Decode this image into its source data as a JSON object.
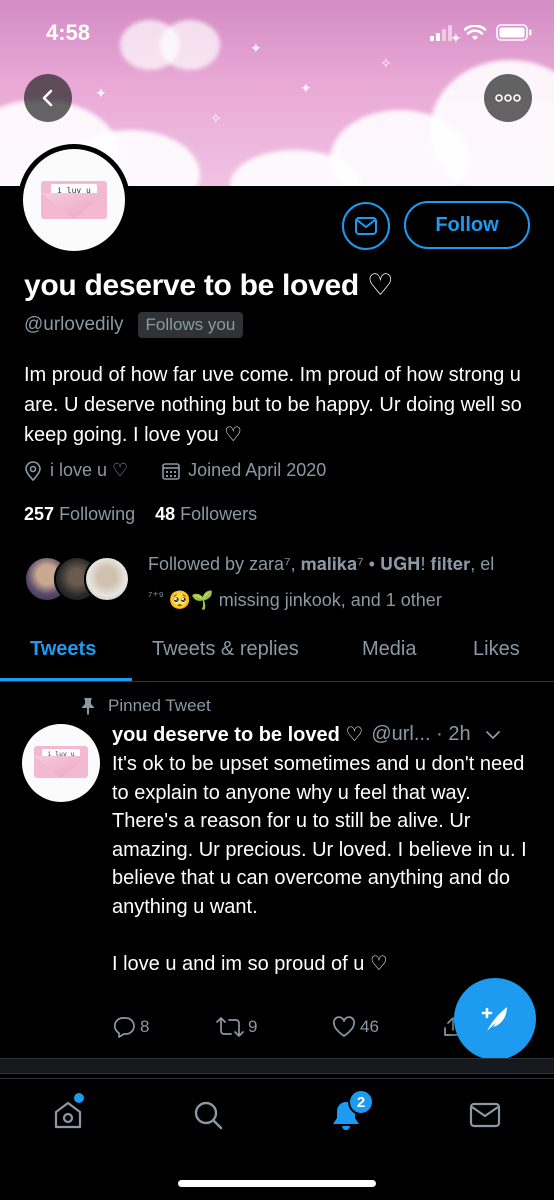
{
  "status_bar": {
    "time": "4:58"
  },
  "profile": {
    "avatar_note": "i luv u <3",
    "name": "you deserve to be loved ♡",
    "handle": "@urlovedily",
    "follows_you": "Follows you",
    "follow_label": "Follow",
    "bio": "Im proud of how far uve come. Im proud of how strong u are. U deserve nothing but to be happy. Ur doing well so keep going. I love you ♡",
    "location": "i love u ♡",
    "joined": "Joined April 2020",
    "following_count": "257",
    "following_label": "Following",
    "followers_count": "48",
    "followers_label": "Followers",
    "followed_by_line1": "Followed by zara⁷, 𝐦𝐚𝐥𝐢𝐤𝐚⁷ • 𝐔𝐆𝐇! 𝐟𝐢𝐥𝐭𝐞𝐫, el",
    "followed_by_line2_prefix": "⁷⁺⁹",
    "followed_by_emoji": "🥺🌱",
    "followed_by_line2_rest": "missing jinkook, and 1 other"
  },
  "tabs": [
    {
      "label": "Tweets",
      "active": true
    },
    {
      "label": "Tweets & replies",
      "active": false
    },
    {
      "label": "Media",
      "active": false
    },
    {
      "label": "Likes",
      "active": false
    }
  ],
  "tweet": {
    "pinned_label": "Pinned Tweet",
    "name": "you deserve to be loved ♡",
    "handle_time": "@url... · 2h",
    "avatar_note": "i luv u <3",
    "text": "It's ok to be upset sometimes and u don't need to explain to anyone why u feel that way. There's a reason for u to still be alive. Ur amazing. Ur precious. Ur loved. I believe in u. I believe that u can overcome anything and do anything u want.\n\nI love u and im so proud of u ♡",
    "replies": "8",
    "retweets": "9",
    "likes": "46"
  },
  "bottom_nav": {
    "notifications_badge": "2"
  },
  "colors": {
    "accent": "#1d9bf0",
    "secondary_text": "#8b98a5",
    "banner_pink": "#e9a9d6"
  }
}
